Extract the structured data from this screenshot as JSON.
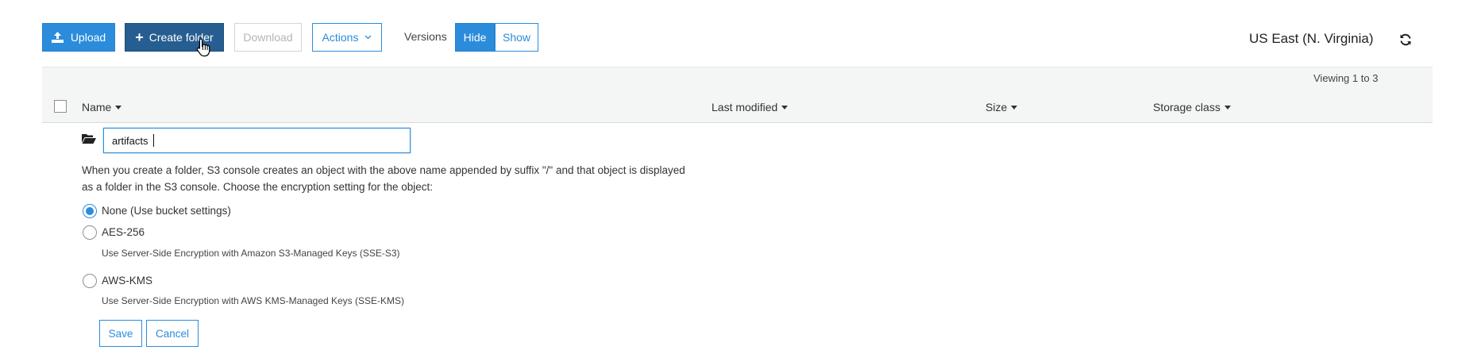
{
  "toolbar": {
    "upload_label": "Upload",
    "create_folder_label": "Create folder",
    "download_label": "Download",
    "actions_label": "Actions",
    "versions_label": "Versions",
    "hide_label": "Hide",
    "show_label": "Show"
  },
  "region": {
    "label": "US East (N. Virginia)"
  },
  "list": {
    "viewing_text": "Viewing 1 to 3",
    "columns": [
      "Name",
      "Last modified",
      "Size",
      "Storage class"
    ]
  },
  "new_folder": {
    "name_value": "artifacts",
    "description": "When you create a folder, S3 console creates an object with the above name appended by suffix \"/\" and that object is displayed as a folder in the S3 console. Choose the encryption setting for the object:",
    "options": [
      {
        "label": "None (Use bucket settings)",
        "note": "",
        "selected": true
      },
      {
        "label": "AES-256",
        "note": "Use Server-Side Encryption with Amazon S3-Managed Keys (SSE-S3)",
        "selected": false
      },
      {
        "label": "AWS-KMS",
        "note": "Use Server-Side Encryption with AWS KMS-Managed Keys (SSE-KMS)",
        "selected": false
      }
    ],
    "save_label": "Save",
    "cancel_label": "Cancel"
  },
  "colors": {
    "primary": "#2c8cdc",
    "primary_dark": "#275e91",
    "band_bg": "#f4f5f5",
    "text": "#333333"
  }
}
